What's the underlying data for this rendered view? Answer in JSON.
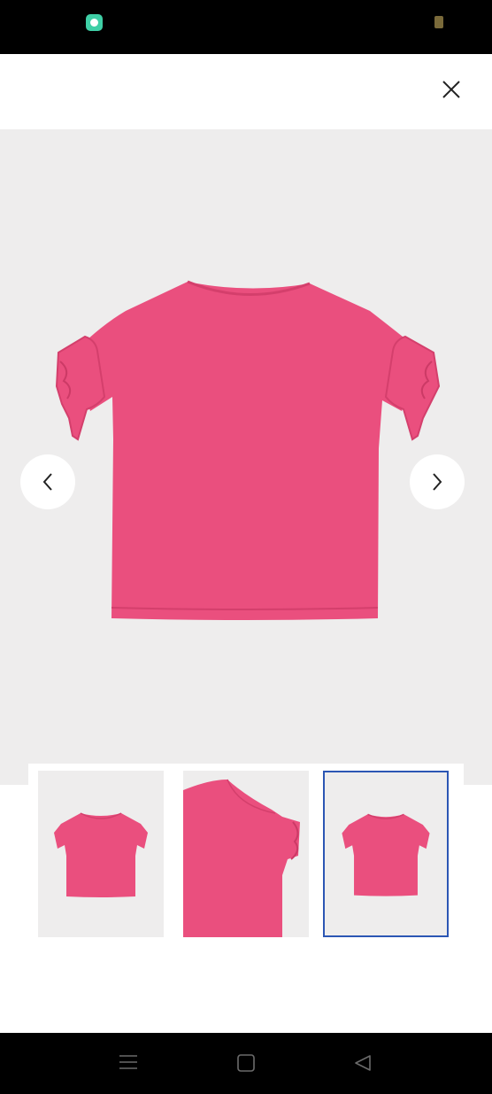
{
  "status_bar": {
    "left_icon": "chat-notification-icon",
    "right_icon": "battery-icon"
  },
  "header": {
    "close_icon": "close-icon"
  },
  "gallery": {
    "main_image": "pink-ruffle-sleeve-tshirt-back-view",
    "prev_icon": "chevron-left-icon",
    "next_icon": "chevron-right-icon",
    "background_color": "#eeeded",
    "product_color": "#ea4f7e"
  },
  "thumbnails": [
    {
      "name": "tshirt-front-view",
      "selected": false
    },
    {
      "name": "tshirt-sleeve-detail",
      "selected": false
    },
    {
      "name": "tshirt-back-view",
      "selected": true
    }
  ],
  "selection_color": "#2c56b4",
  "system_nav": {
    "menu_icon": "menu-icon",
    "home_icon": "square-home-icon",
    "back_icon": "triangle-back-icon"
  }
}
